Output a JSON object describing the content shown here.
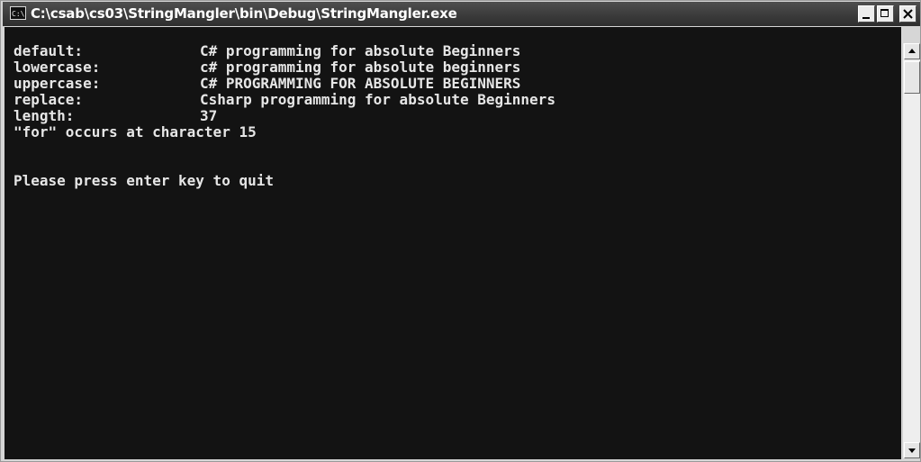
{
  "window": {
    "title": "C:\\csab\\cs03\\StringMangler\\bin\\Debug\\StringMangler.exe",
    "icon_text": "C:\\",
    "buttons": [
      "minimize-icon",
      "maximize-icon",
      "close-icon"
    ]
  },
  "console": {
    "lines": [
      {
        "label": "default:",
        "value": "C# programming for absolute Beginners"
      },
      {
        "label": "lowercase:",
        "value": "c# programming for absolute beginners"
      },
      {
        "label": "uppercase:",
        "value": "C# PROGRAMMING FOR ABSOLUTE BEGINNERS"
      },
      {
        "label": "replace:",
        "value": "Csharp programming for absolute Beginners"
      },
      {
        "label": "length:",
        "value": "37"
      }
    ],
    "occurrence": "\"for\" occurs at character 15",
    "prompt": "Please press enter key to quit"
  },
  "colors": {
    "console_bg": "#131313",
    "console_text": "#e6e6e6",
    "titlebar": "#3b3b3b"
  },
  "icons": {
    "title_icon": "console-icon",
    "scroll_up": "arrow-up-icon",
    "scroll_down": "arrow-down-icon"
  }
}
